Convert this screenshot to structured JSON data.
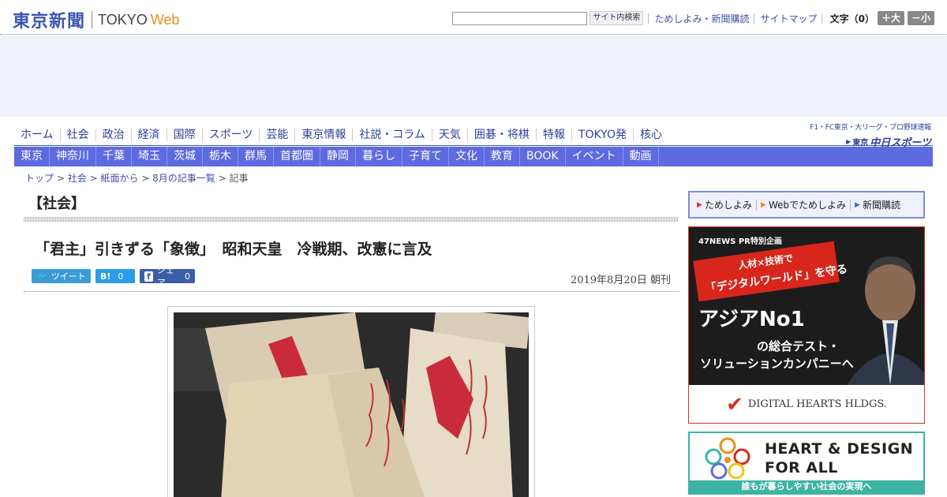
{
  "header": {
    "logo_jp": "東京新聞",
    "logo_tokyo": "TOKYO",
    "logo_web": "Web",
    "search_button": "サイト内検索",
    "links": [
      "ためしよみ・新聞購読",
      "サイトマップ"
    ],
    "font_size_label": "文字（0）",
    "font_plus": "＋大",
    "font_minus": "－小"
  },
  "nav_primary": [
    "ホーム",
    "社会",
    "政治",
    "経済",
    "国際",
    "スポーツ",
    "芸能",
    "東京情報",
    "社説・コラム",
    "天気",
    "囲碁・将棋",
    "特報",
    "TOKYO発",
    "核心"
  ],
  "nav_secondary": [
    "東京",
    "神奈川",
    "千葉",
    "埼玉",
    "茨城",
    "栃木",
    "群馬",
    "首都圏",
    "静岡",
    "暮らし",
    "子育て",
    "文化",
    "教育",
    "BOOK",
    "イベント",
    "動画"
  ],
  "chunichi": {
    "top_line": "F1・FC東京・大リーグ・プロ野球速報",
    "small": "東京",
    "big": "中日スポーツ"
  },
  "breadcrumb": {
    "items": [
      "トップ",
      "社会",
      "紙面から",
      "8月の記事一覧"
    ],
    "current": "記事"
  },
  "article": {
    "section": "【社会】",
    "headline": "「君主」引きずる「象徴」　昭和天皇　冷戦期、改憲に言及",
    "date": "2019年8月20日 朝刊"
  },
  "share": {
    "twitter_label": "ツイート",
    "hatena_label": "B!",
    "hatena_count": "0",
    "facebook_label": "シェア",
    "facebook_count": "0"
  },
  "sidebar": {
    "subscribe": [
      "ためしよみ",
      "Webでためしよみ",
      "新聞購読"
    ],
    "ad1": {
      "badge": "47NEWS PR特別企画",
      "ribbon_line1": "人材×技術で",
      "ribbon_line2": "「デジタルワールド」を守る",
      "big_text": "アジアNo1",
      "line2": "の総合テスト・",
      "line3": "ソリューションカンパニーへ",
      "brand": "DIGITAL HEARTS HLDGS."
    },
    "ad2": {
      "line1": "HEART & DESIGN",
      "line2": "FOR ALL",
      "bar": "誰もが暮らしやすい社会の実現へ"
    }
  },
  "colors": {
    "brand_blue": "#3c55b0",
    "nav_bar": "#5d6ae0",
    "accent_orange": "#e8901a",
    "ad_red": "#d73226",
    "teal": "#3db3a3"
  }
}
